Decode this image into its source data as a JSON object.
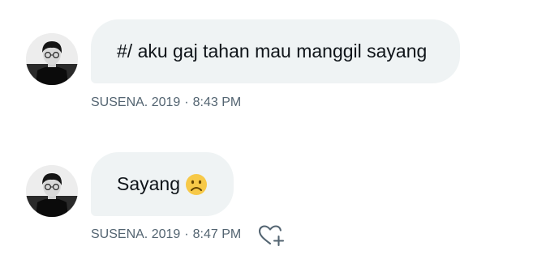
{
  "messages": [
    {
      "text": "#/ aku gaj tahan mau manggil sayang",
      "sender": "SUSENA. 2019",
      "separator": "·",
      "time": "8:43 PM"
    },
    {
      "text": "Sayang",
      "emoji": "☹",
      "emoji_name": "frowning-face",
      "sender": "SUSENA. 2019",
      "separator": "·",
      "time": "8:47 PM",
      "react_icon": "heart-plus-icon"
    }
  ],
  "colors": {
    "bubble": "#eff3f4",
    "text": "#0f1419",
    "meta": "#536471",
    "emoji": "#f7c948"
  }
}
